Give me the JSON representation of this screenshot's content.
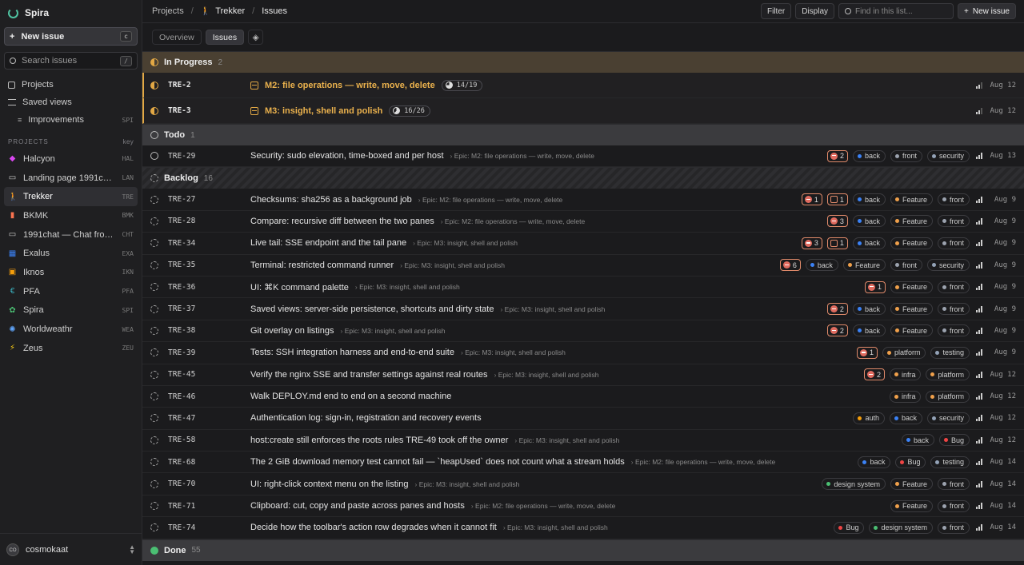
{
  "app": {
    "name": "Spira"
  },
  "sidebar": {
    "new_issue": "New issue",
    "new_issue_key": "c",
    "search_placeholder": "Search issues",
    "search_key": "/",
    "nav": {
      "projects": "Projects",
      "saved_views": "Saved views",
      "improvements": "Improvements",
      "improvements_code": "SPI"
    },
    "projects_heading": "PROJECTS",
    "projects_key_heading": "key",
    "projects": [
      {
        "name": "Halcyon",
        "code": "HAL",
        "icon": "cube-icon",
        "color": "#d946ef"
      },
      {
        "name": "Landing page 1991com...",
        "code": "LAN",
        "icon": "chat-icon",
        "color": "#cccccc"
      },
      {
        "name": "Trekker",
        "code": "TRE",
        "icon": "hiker-icon",
        "color": "#e2a845"
      },
      {
        "name": "BKMK",
        "code": "BMK",
        "icon": "bookmark-icon",
        "color": "#f97350"
      },
      {
        "name": "1991chat — Chat front-...",
        "code": "CHT",
        "icon": "chat-icon",
        "color": "#cccccc"
      },
      {
        "name": "Exalus",
        "code": "EXA",
        "icon": "grid-icon",
        "color": "#3b82f6"
      },
      {
        "name": "Iknos",
        "code": "IKN",
        "icon": "box-icon",
        "color": "#f59e0b"
      },
      {
        "name": "PFA",
        "code": "PFA",
        "icon": "euro-icon",
        "color": "#3bb6c4"
      },
      {
        "name": "Spira",
        "code": "SPI",
        "icon": "leaf-icon",
        "color": "#4bbf73"
      },
      {
        "name": "Worldweathr",
        "code": "WEA",
        "icon": "sparkle-icon",
        "color": "#60a5fa"
      },
      {
        "name": "Zeus",
        "code": "ZEU",
        "icon": "bolt-icon",
        "color": "#facc15"
      }
    ],
    "user": {
      "initials": "CO",
      "name": "cosmokaat"
    }
  },
  "topbar": {
    "crumbs": [
      "Projects",
      "Trekker",
      "Issues"
    ],
    "filter": "Filter",
    "display": "Display",
    "find_placeholder": "Find in this list...",
    "new_issue": "New issue"
  },
  "tabs": [
    "Overview",
    "Issues"
  ],
  "groups": {
    "in_progress": {
      "name": "In Progress",
      "count": "2"
    },
    "todo": {
      "name": "Todo",
      "count": "1"
    },
    "backlog": {
      "name": "Backlog",
      "count": "16"
    },
    "done": {
      "name": "Done",
      "count": "55"
    }
  },
  "in_progress_rows": [
    {
      "id": "TRE-2",
      "title": "M2: file operations — write, move, delete",
      "progress": "14/19",
      "date": "Aug 12"
    },
    {
      "id": "TRE-3",
      "title": "M3: insight, shell and polish",
      "progress": "16/26",
      "date": "Aug 12"
    }
  ],
  "todo_rows": [
    {
      "id": "TRE-29",
      "title": "Security: sudo elevation, time-boxed and per host",
      "epic": "Epic: M2: file operations — write, move, delete",
      "badges": [
        {
          "n": "2"
        }
      ],
      "labels": [
        "back",
        "front",
        "security"
      ],
      "date": "Aug 13"
    }
  ],
  "backlog_rows": [
    {
      "id": "TRE-27",
      "title": "Checksums: sha256 as a background job",
      "epic": "Epic: M2: file operations — write, move, delete",
      "badges": [
        {
          "n": "1"
        },
        {
          "n": "1",
          "sub": true
        }
      ],
      "labels": [
        "back",
        "Feature",
        "front"
      ],
      "date": "Aug 9"
    },
    {
      "id": "TRE-28",
      "title": "Compare: recursive diff between the two panes",
      "epic": "Epic: M2: file operations — write, move, delete",
      "badges": [
        {
          "n": "3"
        }
      ],
      "labels": [
        "back",
        "Feature",
        "front"
      ],
      "date": "Aug 9"
    },
    {
      "id": "TRE-34",
      "title": "Live tail: SSE endpoint and the tail pane",
      "epic": "Epic: M3: insight, shell and polish",
      "badges": [
        {
          "n": "3"
        },
        {
          "n": "1",
          "sub": true
        }
      ],
      "labels": [
        "back",
        "Feature",
        "front"
      ],
      "date": "Aug 9"
    },
    {
      "id": "TRE-35",
      "title": "Terminal: restricted command runner",
      "epic": "Epic: M3: insight, shell and polish",
      "badges": [
        {
          "n": "6"
        }
      ],
      "labels": [
        "back",
        "Feature",
        "front",
        "security"
      ],
      "date": "Aug 9"
    },
    {
      "id": "TRE-36",
      "title": "UI: ⌘K command palette",
      "epic": "Epic: M3: insight, shell and polish",
      "badges": [
        {
          "n": "1"
        }
      ],
      "labels": [
        "Feature",
        "front"
      ],
      "date": "Aug 9"
    },
    {
      "id": "TRE-37",
      "title": "Saved views: server-side persistence, shortcuts and dirty state",
      "epic": "Epic: M3: insight, shell and polish",
      "badges": [
        {
          "n": "2"
        }
      ],
      "labels": [
        "back",
        "Feature",
        "front"
      ],
      "date": "Aug 9"
    },
    {
      "id": "TRE-38",
      "title": "Git overlay on listings",
      "epic": "Epic: M3: insight, shell and polish",
      "badges": [
        {
          "n": "2"
        }
      ],
      "labels": [
        "back",
        "Feature",
        "front"
      ],
      "date": "Aug 9"
    },
    {
      "id": "TRE-39",
      "title": "Tests: SSH integration harness and end-to-end suite",
      "epic": "Epic: M3: insight, shell and polish",
      "badges": [
        {
          "n": "1"
        }
      ],
      "labels": [
        "platform",
        "testing"
      ],
      "date": "Aug 9"
    },
    {
      "id": "TRE-45",
      "title": "Verify the nginx SSE and transfer settings against real routes",
      "epic": "Epic: M3: insight, shell and polish",
      "badges": [
        {
          "n": "2"
        }
      ],
      "labels": [
        "infra",
        "platform"
      ],
      "date": "Aug 12"
    },
    {
      "id": "TRE-46",
      "title": "Walk DEPLOY.md end to end on a second machine",
      "epic": "",
      "badges": [],
      "labels": [
        "infra",
        "platform"
      ],
      "date": "Aug 12"
    },
    {
      "id": "TRE-47",
      "title": "Authentication log: sign-in, registration and recovery events",
      "epic": "",
      "badges": [],
      "labels": [
        "auth",
        "back",
        "security"
      ],
      "date": "Aug 12"
    },
    {
      "id": "TRE-58",
      "title": "host:create still enforces the roots rules TRE-49 took off the owner",
      "epic": "Epic: M3: insight, shell and polish",
      "badges": [],
      "labels": [
        "back",
        "Bug"
      ],
      "date": "Aug 12"
    },
    {
      "id": "TRE-68",
      "title": "The 2 GiB download memory test cannot fail — `heapUsed` does not count what a stream holds",
      "epic": "Epic: M2: file operations — write, move, delete",
      "badges": [],
      "labels": [
        "back",
        "Bug",
        "testing"
      ],
      "date": "Aug 14"
    },
    {
      "id": "TRE-70",
      "title": "UI: right-click context menu on the listing",
      "epic": "Epic: M3: insight, shell and polish",
      "badges": [],
      "labels": [
        "design system",
        "Feature",
        "front"
      ],
      "date": "Aug 14"
    },
    {
      "id": "TRE-71",
      "title": "Clipboard: cut, copy and paste across panes and hosts",
      "epic": "Epic: M2: file operations — write, move, delete",
      "badges": [],
      "labels": [
        "Feature",
        "front"
      ],
      "date": "Aug 14"
    },
    {
      "id": "TRE-74",
      "title": "Decide how the toolbar's action row degrades when it cannot fit",
      "epic": "Epic: M3: insight, shell and polish",
      "badges": [],
      "labels": [
        "Bug",
        "design system",
        "front"
      ],
      "date": "Aug 14"
    }
  ],
  "label_colors": {
    "back": "#3b82f6",
    "front": "#9ca3af",
    "security": "#94a3b8",
    "Feature": "#f0a04b",
    "platform": "#f0a04b",
    "testing": "#94a3b8",
    "infra": "#f0a04b",
    "auth": "#f59e0b",
    "Bug": "#ef4444",
    "design system": "#4bbf73"
  }
}
